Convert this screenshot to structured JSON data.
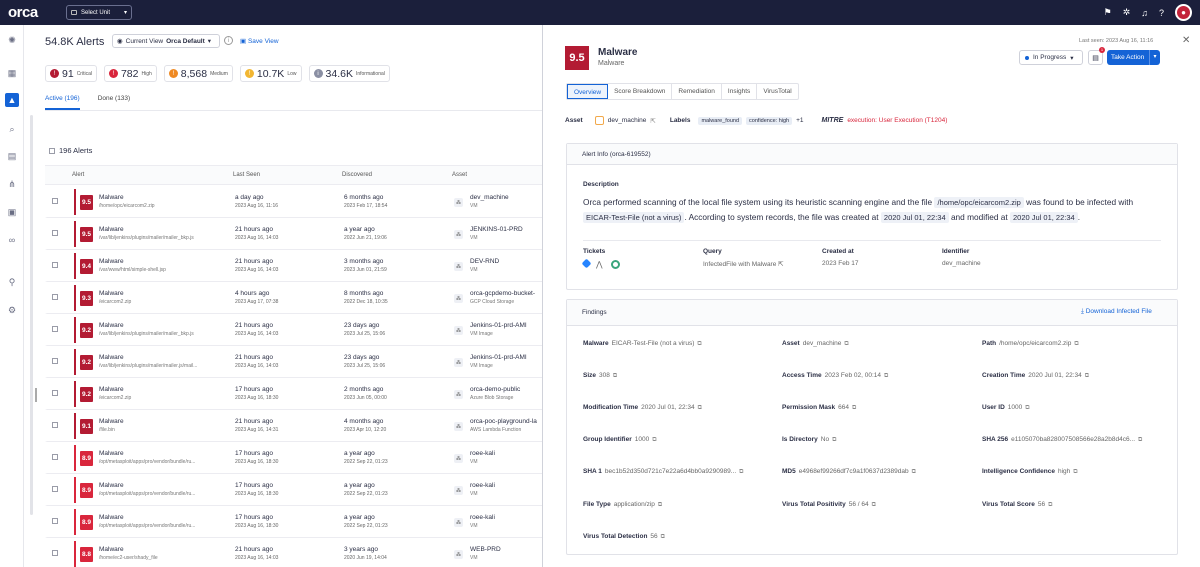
{
  "app": {
    "logo": "orca",
    "unit_select": "Select Unit"
  },
  "topbar": {
    "icons": [
      "flag-icon",
      "bug-icon",
      "bell-icon",
      "help-icon"
    ]
  },
  "list": {
    "title": "54.8K Alerts",
    "view_label": "Current View",
    "view_value": "Orca Default",
    "save_view": "Save View",
    "severities": [
      {
        "num": "91",
        "label": "Critical",
        "color": "#b31b33"
      },
      {
        "num": "782",
        "label": "High",
        "color": "#d9263c"
      },
      {
        "num": "8,568",
        "label": "Medium",
        "color": "#ef8a24"
      },
      {
        "num": "10.7K",
        "label": "Low",
        "color": "#f2b632"
      },
      {
        "num": "34.6K",
        "label": "Informational",
        "color": "#8a8fa3"
      }
    ],
    "tabs": [
      "Active (196)",
      "Done (133)"
    ],
    "count": "196 Alerts",
    "columns": [
      "Alert",
      "Last Seen",
      "Discovered",
      "Asset"
    ],
    "rows": [
      {
        "score": "9.5",
        "name": "Malware",
        "path": "/home/opc/eicarcom2.zip",
        "last": "a day ago",
        "last_date": "2023 Aug 16, 11:16",
        "disc": "6 months ago",
        "disc_date": "2023 Feb 17, 18:54",
        "asset": "dev_machine",
        "atype": "VM",
        "color": "#b31b33"
      },
      {
        "score": "9.5",
        "name": "Malware",
        "path": "/var/lib/jenkins/plugins/mailer/mailer_bkp.js",
        "last": "21 hours ago",
        "last_date": "2023 Aug 16, 14:03",
        "disc": "a year ago",
        "disc_date": "2022 Jun 21, 19:06",
        "asset": "JENKINS-01-PRD",
        "atype": "VM",
        "color": "#b31b33"
      },
      {
        "score": "9.4",
        "name": "Malware",
        "path": "/var/www/html/simple-shell.jsp",
        "last": "21 hours ago",
        "last_date": "2023 Aug 16, 14:03",
        "disc": "3 months ago",
        "disc_date": "2023 Jun 01, 21:59",
        "asset": "DEV-RND",
        "atype": "VM",
        "color": "#b31b33"
      },
      {
        "score": "9.3",
        "name": "Malware",
        "path": "/eicarcom2.zip",
        "last": "4 hours ago",
        "last_date": "2023 Aug 17, 07:38",
        "disc": "8 months ago",
        "disc_date": "2022 Dec 18, 10:35",
        "asset": "orca-gcpdemo-bucket-",
        "atype": "GCP Cloud Storage",
        "color": "#b31b33"
      },
      {
        "score": "9.2",
        "name": "Malware",
        "path": "/var/lib/jenkins/plugins/mailer/mailer_bkp.js",
        "last": "21 hours ago",
        "last_date": "2023 Aug 16, 14:03",
        "disc": "23 days ago",
        "disc_date": "2023 Jul 25, 15:06",
        "asset": "Jenkins-01-prd-AMI",
        "atype": "VM Image",
        "color": "#b31b33"
      },
      {
        "score": "9.2",
        "name": "Malware",
        "path": "/var/lib/jenkins/plugins/mailer/mailer.js/mail...",
        "last": "21 hours ago",
        "last_date": "2023 Aug 16, 14:03",
        "disc": "23 days ago",
        "disc_date": "2023 Jul 25, 15:06",
        "asset": "Jenkins-01-prd-AMI",
        "atype": "VM Image",
        "color": "#b31b33"
      },
      {
        "score": "9.2",
        "name": "Malware",
        "path": "/eicarcom2.zip",
        "last": "17 hours ago",
        "last_date": "2023 Aug 16, 18:30",
        "disc": "2 months ago",
        "disc_date": "2023 Jun 05, 00:00",
        "asset": "orca-demo-public",
        "atype": "Azure Blob Storage",
        "color": "#b31b33"
      },
      {
        "score": "9.1",
        "name": "Malware",
        "path": "/file.bin",
        "last": "21 hours ago",
        "last_date": "2023 Aug 16, 14:31",
        "disc": "4 months ago",
        "disc_date": "2023 Apr 10, 12:20",
        "asset": "orca-poc-playground-la",
        "atype": "AWS Lambda Function",
        "color": "#b31b33"
      },
      {
        "score": "8.9",
        "name": "Malware",
        "path": "/opt/metasploit/apps/pro/vendor/bundle/ru...",
        "last": "17 hours ago",
        "last_date": "2023 Aug 16, 18:30",
        "disc": "a year ago",
        "disc_date": "2022 Sep 22, 01:23",
        "asset": "roee-kali",
        "atype": "VM",
        "color": "#d9263c"
      },
      {
        "score": "8.9",
        "name": "Malware",
        "path": "/opt/metasploit/apps/pro/vendor/bundle/ru...",
        "last": "17 hours ago",
        "last_date": "2023 Aug 16, 18:30",
        "disc": "a year ago",
        "disc_date": "2022 Sep 22, 01:23",
        "asset": "roee-kali",
        "atype": "VM",
        "color": "#d9263c"
      },
      {
        "score": "8.9",
        "name": "Malware",
        "path": "/opt/metasploit/apps/pro/vendor/bundle/ru...",
        "last": "17 hours ago",
        "last_date": "2023 Aug 16, 18:30",
        "disc": "a year ago",
        "disc_date": "2022 Sep 22, 01:23",
        "asset": "roee-kali",
        "atype": "VM",
        "color": "#d9263c"
      },
      {
        "score": "8.8",
        "name": "Malware",
        "path": "/home/ec2-user/shady_file",
        "last": "21 hours ago",
        "last_date": "2023 Aug 16, 14:03",
        "disc": "3 years ago",
        "disc_date": "2020 Jun 19, 14:04",
        "asset": "WEB-PRD",
        "atype": "VM",
        "color": "#d9263c"
      }
    ]
  },
  "panel": {
    "last_seen": "Last seen: 2023 Aug 16, 11:16",
    "score": "9.5",
    "title": "Malware",
    "subtitle": "Malware",
    "status": "In Progress",
    "comment_count": "1",
    "take_action": "Take Action",
    "tabs": [
      "Overview",
      "Score Breakdown",
      "Remediation",
      "Insights",
      "VirusTotal"
    ],
    "asset_label": "Asset",
    "asset_value": "dev_machine",
    "labels_label": "Labels",
    "labels": [
      "malware_found",
      "confidence: high"
    ],
    "labels_more": "+1",
    "mitre": "MITRE",
    "mitre_text": "execution: User Execution (T1204)",
    "alert_info": "Alert Info (orca-619552)",
    "desc_label": "Description",
    "desc_1": "Orca performed scanning of the local file system using its heuristic scanning engine and the file",
    "desc_code1": "/home/opc/eicarcom2.zip",
    "desc_2": "was found to be infected with",
    "desc_code2": "EICAR-Test-File (not a virus)",
    "desc_3": ". According to system records, the file was created at",
    "desc_code3": "2020 Jul 01, 22:34",
    "desc_4": "and modified at",
    "desc_code4": "2020 Jul 01, 22:34",
    "desc_5": ".",
    "tickets_label": "Tickets",
    "query_label": "Query",
    "query_value": "InfectedFile with Malware",
    "created_label": "Created at",
    "created_value": "2023 Feb 17",
    "identifier_label": "Identifier",
    "identifier_value": "dev_machine",
    "findings": "Findings",
    "download": "Download Infected File",
    "fields": [
      {
        "k": "Malware",
        "v": "EICAR-Test-File (not a virus)"
      },
      {
        "k": "Asset",
        "v": "dev_machine"
      },
      {
        "k": "Path",
        "v": "/home/opc/eicarcom2.zip"
      },
      {
        "k": "Size",
        "v": "308"
      },
      {
        "k": "Access Time",
        "v": "2023 Feb 02, 00:14"
      },
      {
        "k": "Creation Time",
        "v": "2020 Jul 01, 22:34"
      },
      {
        "k": "Modification Time",
        "v": "2020 Jul 01, 22:34"
      },
      {
        "k": "Permission Mask",
        "v": "664"
      },
      {
        "k": "User ID",
        "v": "1000"
      },
      {
        "k": "Group Identifier",
        "v": "1000"
      },
      {
        "k": "Is Directory",
        "v": "No"
      },
      {
        "k": "SHA 256",
        "v": "e1105070ba828007508566e28a2b8d4c6..."
      },
      {
        "k": "SHA 1",
        "v": "bec1b52d350d721c7e22a6d4bb0a9290989..."
      },
      {
        "k": "MD5",
        "v": "e4968ef99266df7c9a1f0637d2389dab"
      },
      {
        "k": "Intelligence Confidence",
        "v": "high"
      },
      {
        "k": "File Type",
        "v": "application/zip"
      },
      {
        "k": "Virus Total Positivity",
        "v": "56 / 64"
      },
      {
        "k": "Virus Total Score",
        "v": "56"
      },
      {
        "k": "Virus Total Detection",
        "v": "56"
      }
    ]
  }
}
